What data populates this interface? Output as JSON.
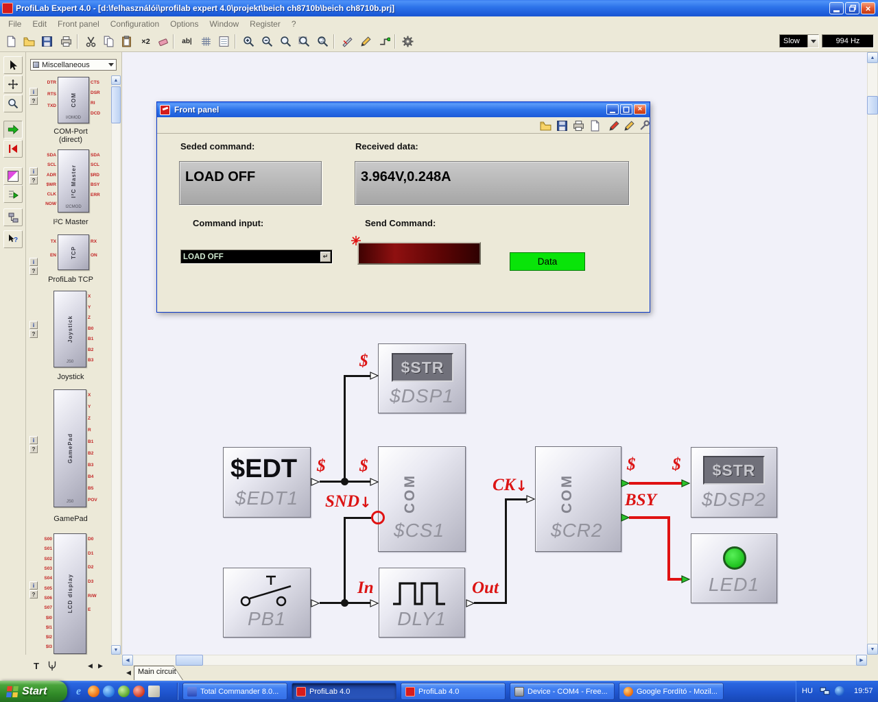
{
  "titlebar": {
    "title": "ProfiLab Expert 4.0 - [d:\\felhasználói\\profilab expert 4.0\\projekt\\beich ch8710b\\beich ch8710b.prj]"
  },
  "menubar": {
    "items": [
      "File",
      "Edit",
      "Front panel",
      "Configuration",
      "Options",
      "Window",
      "Register",
      "?"
    ]
  },
  "toolbar": {
    "x2": "×2",
    "ab": "ab|",
    "speed": "Slow",
    "frequency": "994 Hz"
  },
  "palette": {
    "category": "Miscellaneous",
    "info": "i",
    "help": "?",
    "items": [
      {
        "chip": "COM",
        "sub": "I/OMOD",
        "label1": "COM-Port",
        "label2": "(direct)",
        "pl": [
          "DTR",
          "RTS",
          "TXD"
        ],
        "pr": [
          "CTS",
          "DSR",
          "RI",
          "DCD"
        ]
      },
      {
        "chip": "I²C Master",
        "sub": "I2CMOD",
        "label1": "I²C Master",
        "label2": "",
        "pl": [
          "SDA",
          "SCL",
          "ADR",
          "$WR",
          "CLK",
          "NOW"
        ],
        "pr": [
          "SDA",
          "SCL",
          "$RD",
          "BSY",
          "ERR"
        ]
      },
      {
        "chip": "TCP",
        "sub": "",
        "label1": "ProfiLab TCP",
        "label2": "",
        "pl": [
          "TX",
          "EN"
        ],
        "pr": [
          "RX",
          "ON"
        ]
      },
      {
        "chip": "Joystick",
        "sub": "JS0",
        "label1": "Joystick",
        "label2": "",
        "pl": [],
        "pr": [
          "X",
          "Y",
          "Z",
          "B0",
          "B1",
          "B2",
          "B3"
        ]
      },
      {
        "chip": "GamePad",
        "sub": "JS0",
        "label1": "GamePad",
        "label2": "",
        "pl": [],
        "pr": [
          "X",
          "Y",
          "Z",
          "R",
          "B1",
          "B2",
          "B3",
          "B4",
          "B5",
          "POV"
        ]
      },
      {
        "chip": "LCD display",
        "sub": "",
        "label1": "",
        "label2": "",
        "pl": [
          "S00",
          "S01",
          "S02",
          "S03",
          "S04",
          "S05",
          "S06",
          "S07",
          "$I0",
          "$I1",
          "$I2",
          "$I3"
        ],
        "pr": [
          "D0",
          "D1",
          "D2",
          "D3",
          "R/W",
          "E"
        ]
      }
    ]
  },
  "front_panel": {
    "title": "Front panel",
    "seded_label": "Seded command:",
    "seded_value": "LOAD OFF",
    "received_label": "Received data:",
    "received_value": "3.964V,0.248A",
    "command_label": "Command input:",
    "command_value": "LOAD OFF",
    "enter_glyph": "↵",
    "send_label": "Send Command:",
    "send_value": "",
    "data_button": "Data"
  },
  "circuit": {
    "edt1": {
      "text": "$EDT",
      "name": "$EDT1"
    },
    "dsp1": {
      "text": "$STR",
      "name": "$DSP1"
    },
    "dsp2": {
      "text": "$STR",
      "name": "$DSP2"
    },
    "cs1": {
      "text": "COM",
      "name": "$CS1"
    },
    "cr2": {
      "text": "COM",
      "name": "$CR2"
    },
    "pb1": {
      "name": "PB1"
    },
    "dly1": {
      "name": "DLY1"
    },
    "led1": {
      "name": "LED1"
    },
    "labels": {
      "dollar": "$",
      "snd": "SND",
      "ck": "CK",
      "bsy": "BSY",
      "in": "In",
      "out": "Out",
      "down": "↓"
    }
  },
  "tabs": {
    "main": "Main circuit"
  },
  "bottom": {
    "text_tool": "T"
  },
  "taskbar": {
    "start": "Start",
    "quicklaunch_e": "e",
    "tasks": [
      {
        "label": "Total Commander 8.0..."
      },
      {
        "label": "ProfiLab 4.0"
      },
      {
        "label": "ProfiLab 4.0"
      },
      {
        "label": "Device - COM4 - Free..."
      },
      {
        "label": "Google Fordító - Mozil..."
      }
    ],
    "tray": {
      "lang": "HU",
      "time": "19:57"
    }
  }
}
